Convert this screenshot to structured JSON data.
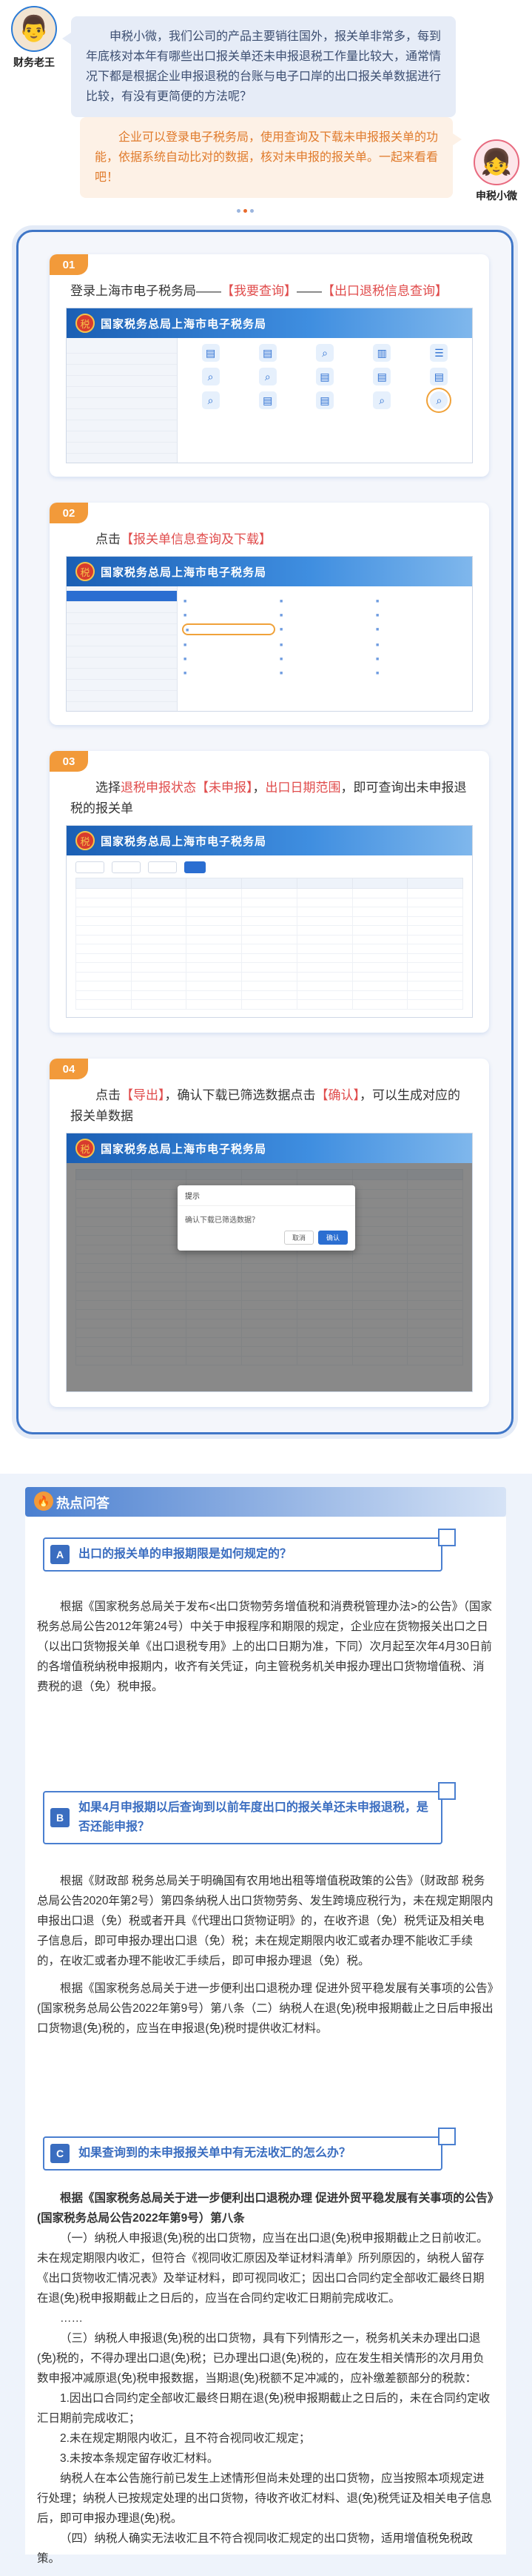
{
  "chat": {
    "left_role": "财务老王",
    "left_message": "申税小微，我们公司的产品主要销往国外，报关单非常多，每到年底核对本年有哪些出口报关单还未申报退税工作量比较大，通常情况下都是根据企业申报退税的台账与电子口岸的出口报关单数据进行比较，有没有更简便的方法呢？",
    "right_role": "申税小微",
    "right_message": "企业可以登录电子税务局，使用查询及下载未申报报关单的功能，依据系统自动比对的数据，核对未申报的报关单。一起来看看吧！"
  },
  "steps": [
    {
      "num": "01",
      "text_plain": "登录上海市电子税务局——",
      "text_hl_1": "【我要查询】",
      "text_mid": "——",
      "text_hl_2": "【出口退税信息查询】"
    },
    {
      "num": "02",
      "text_plain": "点击",
      "text_hl_1": "【报关单信息查询及下载】"
    },
    {
      "num": "03",
      "text_a": "选择",
      "text_hl_1": "退税申报状态【未申报】",
      "text_b": "，",
      "text_hl_2": "出口日期范围",
      "text_c": "，即可查询出未申报退税的报关单"
    },
    {
      "num": "04",
      "text_a": "点击",
      "text_hl_1": "【导出】",
      "text_b": "，确认下载已筛选数据点击",
      "text_hl_2": "【确认】",
      "text_c": "，可以生成对应的报关单数据"
    }
  ],
  "screens": {
    "site_title": "国家税务总局上海市电子税务局",
    "emblem": "税",
    "dialog_title": "提示",
    "dialog_message": "确认下载已筛选数据？",
    "dialog_cancel": "取消",
    "dialog_ok": "确认"
  },
  "hot": {
    "title": "热点问答",
    "q1_badge": "A",
    "q1": "出口的报关单的申报期限是如何规定的？",
    "a1": "根据《国家税务总局关于发布<出口货物劳务增值税和消费税管理办法>的公告》（国家税务总局公告2012年第24号）中关于申报程序和期限的规定，企业应在货物报关出口之日（以出口货物报关单《出口退税专用》上的出口日期为准，下同）次月起至次年4月30日前的各增值税纳税申报期内，收齐有关凭证，向主管税务机关申报办理出口货物增值税、消费税的退（免）税申报。",
    "q2_badge": "B",
    "q2": "如果4月申报期以后查询到以前年度出口的报关单还未申报退税，是否还能申报？",
    "a2": "根据《财政部 税务总局关于明确国有农用地出租等增值税政策的公告》（财政部 税务总局公告2020年第2号）第四条纳税人出口货物劳务、发生跨境应税行为，未在规定期限内申报出口退（免）税或者开具《代理出口货物证明》的，在收齐退（免）税凭证及相关电子信息后，即可申报办理出口退（免）税；未在规定期限内收汇或者办理不能收汇手续的，在收汇或者办理不能收汇手续后，即可申报办理退（免）税。",
    "a2b": "根据《国家税务总局关于进一步便利出口退税办理 促进外贸平稳发展有关事项的公告》(国家税务总局公告2022年第9号）第八条（二）纳税人在退(免)税申报期截止之日后申报出口货物退(免)税的，应当在申报退(免)税时提供收汇材料。",
    "q3_badge": "C",
    "q3": "如果查询到的未申报报关单中有无法收汇的怎么办？",
    "a3_intro": "根据《国家税务总局关于进一步便利出口退税办理 促进外贸平稳发展有关事项的公告》(国家税务总局公告2022年第9号）第八条",
    "a3_p1": "（一）纳税人申报退(免)税的出口货物，应当在出口退(免)税申报期截止之日前收汇。未在规定期限内收汇，但符合《视同收汇原因及举证材料清单》所列原因的，纳税人留存《出口货物收汇情况表》及举证材料，即可视同收汇；因出口合同约定全部收汇最终日期在退(免)税申报期截止之日后的，应当在合同约定收汇日期前完成收汇。",
    "a3_ellipsis": "……",
    "a3_p2": "（三）纳税人申报退(免)税的出口货物，具有下列情形之一，税务机关未办理出口退(免)税的，不得办理出口退(免)税；已办理出口退(免)税的，应在发生相关情形的次月用负数申报冲减原退(免)税申报数据，当期退(免)税额不足冲减的，应补缴差额部分的税款：",
    "a3_item1": "1.因出口合同约定全部收汇最终日期在退(免)税申报期截止之日后的，未在合同约定收汇日期前完成收汇；",
    "a3_item2": "2.未在规定期限内收汇，且不符合视同收汇规定；",
    "a3_item3": "3.未按本条规定留存收汇材料。",
    "a3_p3": "纳税人在本公告施行前已发生上述情形但尚未处理的出口货物，应当按照本项规定进行处理；纳税人已按规定处理的出口货物，待收齐收汇材料、退(免)税凭证及相关电子信息后，即可申报办理退(免)税。",
    "a3_p4": "（四）纳税人确实无法收汇且不符合视同收汇规定的出口货物，适用增值税免税政策。"
  }
}
